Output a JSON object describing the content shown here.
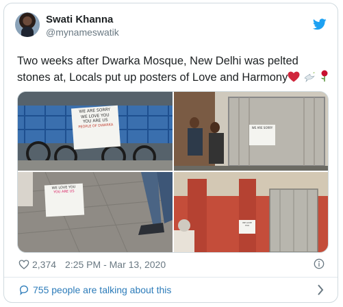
{
  "user": {
    "name": "Swati Khanna",
    "handle": "@mynameswatik"
  },
  "tweet": {
    "text": "Two weeks after Dwarka Mosque, New Delhi was pelted stones at, Locals put up posters of Love and Harmony",
    "emojis": [
      "heart-emoji",
      "dove-emoji",
      "rose-emoji"
    ]
  },
  "photos": {
    "sign_text": [
      "WE ARE SORRY",
      "WE LOVE YOU",
      "YOU ARE US",
      "PEOPLE OF DWARKA"
    ]
  },
  "meta": {
    "likes": "2,374",
    "timestamp": "2:25 PM - Mar 13, 2020"
  },
  "footer": {
    "talking": "755 people are talking about this"
  },
  "colors": {
    "link": "#2b7bb9",
    "twitter": "#1da1f2",
    "muted": "#697882"
  }
}
